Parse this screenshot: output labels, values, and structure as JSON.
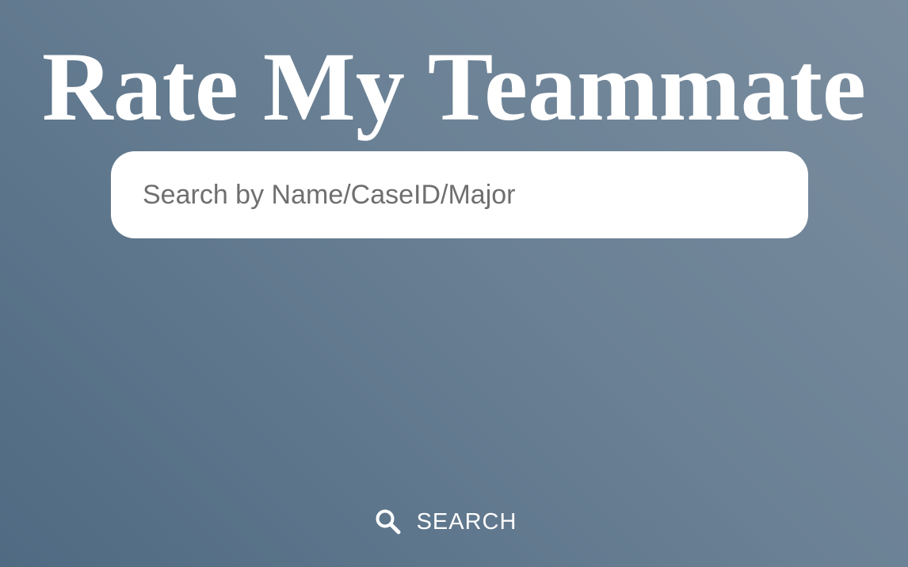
{
  "header": {
    "title": "Rate My Teammate"
  },
  "search": {
    "placeholder": "Search by Name/CaseID/Major",
    "value": "",
    "button_label": "SEARCH",
    "button_icon": "search-icon"
  },
  "colors": {
    "background_gradient": [
      "#7a8d9f",
      "#4f6a82"
    ],
    "title_text": "#ffffff",
    "search_box": "#ffffff"
  }
}
